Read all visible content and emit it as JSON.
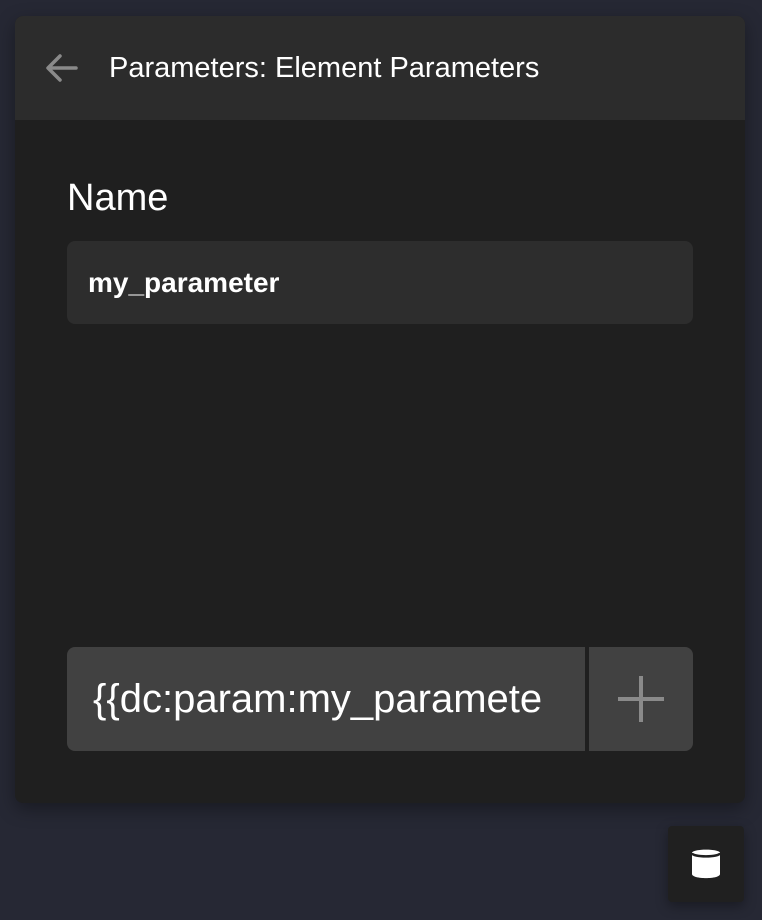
{
  "header": {
    "back_icon": "arrow-left-icon",
    "title": "Parameters: Element Parameters"
  },
  "name_field": {
    "label": "Name",
    "value": "my_parameter"
  },
  "token_field": {
    "value": "{{dc:param:my_paramete",
    "add_icon": "plus-icon"
  },
  "floating_action": {
    "icon": "database-icon"
  },
  "colors": {
    "background": "#262834",
    "panel": "#1f1f1f",
    "header": "#2c2c2c",
    "input": "#2d2d2d",
    "token": "#414141",
    "icon_muted": "#8a8a8a",
    "text": "#ffffff"
  }
}
